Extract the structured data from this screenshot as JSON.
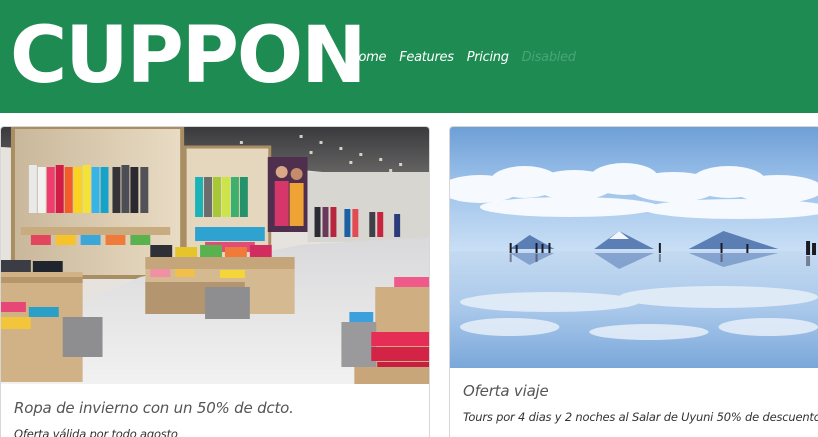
{
  "navbar": {
    "brand": "CUPPON",
    "links": [
      {
        "label": "Home"
      },
      {
        "label": "Features"
      },
      {
        "label": "Pricing"
      },
      {
        "label": "Disabled"
      }
    ],
    "colors": {
      "background": "#1e8c52",
      "disabled_link": "#4aa476"
    }
  },
  "cards": [
    {
      "image": "clothing-store-photo",
      "title": "Ropa de invierno con un 50% de dcto.",
      "text": "Oferta válida por todo agosto"
    },
    {
      "image": "salt-flat-reflection-photo",
      "title": "Oferta viaje",
      "text": "Tours por 4 dias y 2 noches al Salar de Uyuni 50% de descuento"
    }
  ]
}
